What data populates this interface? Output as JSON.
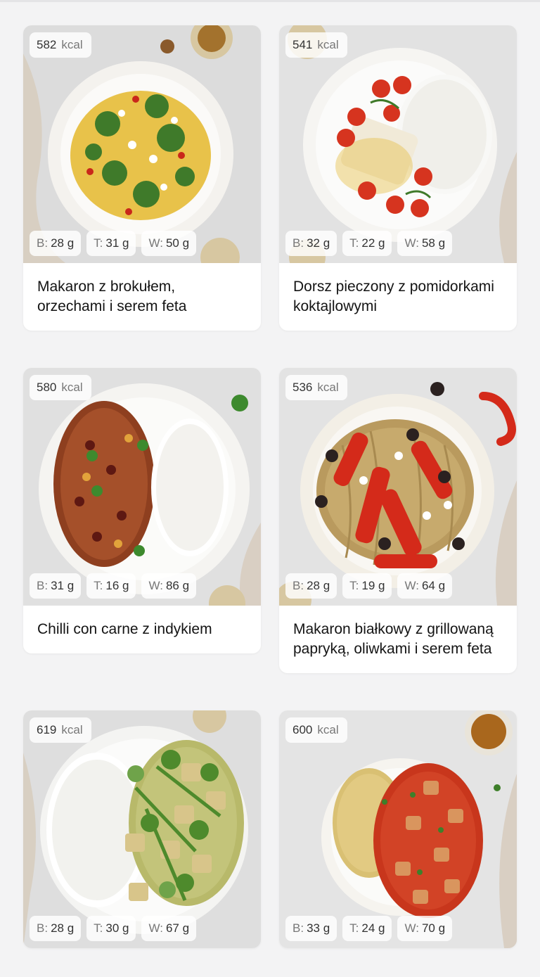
{
  "meals": [
    {
      "kcal": "582",
      "kcal_unit": "kcal",
      "protein_label": "B:",
      "protein": "28 g",
      "fat_label": "T:",
      "fat": "31 g",
      "carbs_label": "W:",
      "carbs": "50 g",
      "title": "Makaron z brokułem, orzechami i serem feta",
      "photo": {
        "bg": "#dcdcdc",
        "plate": "#f4f2ee",
        "food": "#e8c24a",
        "accent": "#3f7a2a",
        "side": "#ffffff"
      }
    },
    {
      "kcal": "541",
      "kcal_unit": "kcal",
      "protein_label": "B:",
      "protein": "32 g",
      "fat_label": "T:",
      "fat": "22 g",
      "carbs_label": "W:",
      "carbs": "58 g",
      "title": "Dorsz pieczony z pomidorkami koktajlowymi",
      "photo": {
        "bg": "#e2e2e2",
        "plate": "#f6f5f2",
        "food": "#f8f8f6",
        "accent": "#d6341f",
        "side": "#f1ead8"
      }
    },
    {
      "kcal": "580",
      "kcal_unit": "kcal",
      "protein_label": "B:",
      "protein": "31 g",
      "fat_label": "T:",
      "fat": "16 g",
      "carbs_label": "W:",
      "carbs": "86 g",
      "title": "Chilli con carne z indykiem",
      "photo": {
        "bg": "#e0e0e0",
        "plate": "#f5f4f1",
        "food": "#8e3f1f",
        "accent": "#3d8a2e",
        "side": "#ffffff"
      }
    },
    {
      "kcal": "536",
      "kcal_unit": "kcal",
      "protein_label": "B:",
      "protein": "28 g",
      "fat_label": "T:",
      "fat": "19 g",
      "carbs_label": "W:",
      "carbs": "64 g",
      "title": "Makaron białkowy z grillowaną papryką, oliwkami i serem feta",
      "photo": {
        "bg": "#e3e3e3",
        "plate": "#f3efe6",
        "food": "#b99a5e",
        "accent": "#d42a1a",
        "side": "#2b2120"
      }
    },
    {
      "kcal": "619",
      "kcal_unit": "kcal",
      "protein_label": "B:",
      "protein": "28 g",
      "fat_label": "T:",
      "fat": "30 g",
      "carbs_label": "W:",
      "carbs": "67 g",
      "title": "",
      "photo": {
        "bg": "#dedede",
        "plate": "#f4f4f2",
        "food": "#b8b96a",
        "accent": "#4e8a2c",
        "side": "#ffffff"
      }
    },
    {
      "kcal": "600",
      "kcal_unit": "kcal",
      "protein_label": "B:",
      "protein": "33 g",
      "fat_label": "T:",
      "fat": "24 g",
      "carbs_label": "W:",
      "carbs": "70 g",
      "title": "",
      "photo": {
        "bg": "#e4e4e4",
        "plate": "#f6f4ef",
        "food": "#c8361c",
        "accent": "#d9c073",
        "side": "#a9671d"
      }
    }
  ]
}
